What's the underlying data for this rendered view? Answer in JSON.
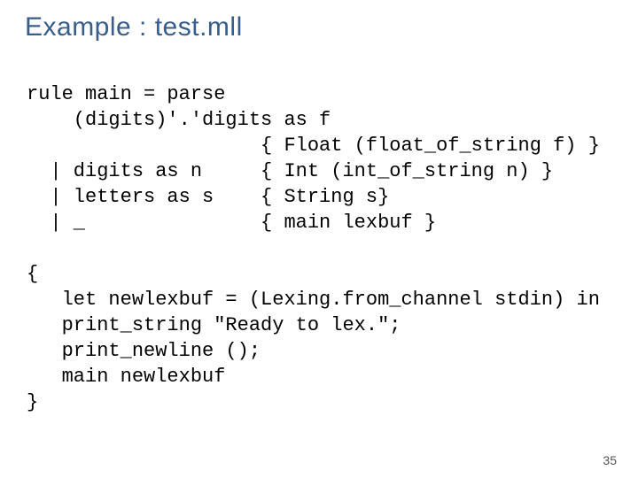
{
  "title": "Example : test.mll",
  "code_lines": [
    "rule main = parse",
    "    (digits)'.'digits as f",
    "                    { Float (float_of_string f) }",
    "  | digits as n     { Int (int_of_string n) }",
    "  | letters as s    { String s}",
    "  | _               { main lexbuf }",
    "",
    "{",
    "   let newlexbuf = (Lexing.from_channel stdin) in",
    "   print_string \"Ready to lex.\";",
    "   print_newline ();",
    "   main newlexbuf",
    "}"
  ],
  "page_number": "35"
}
